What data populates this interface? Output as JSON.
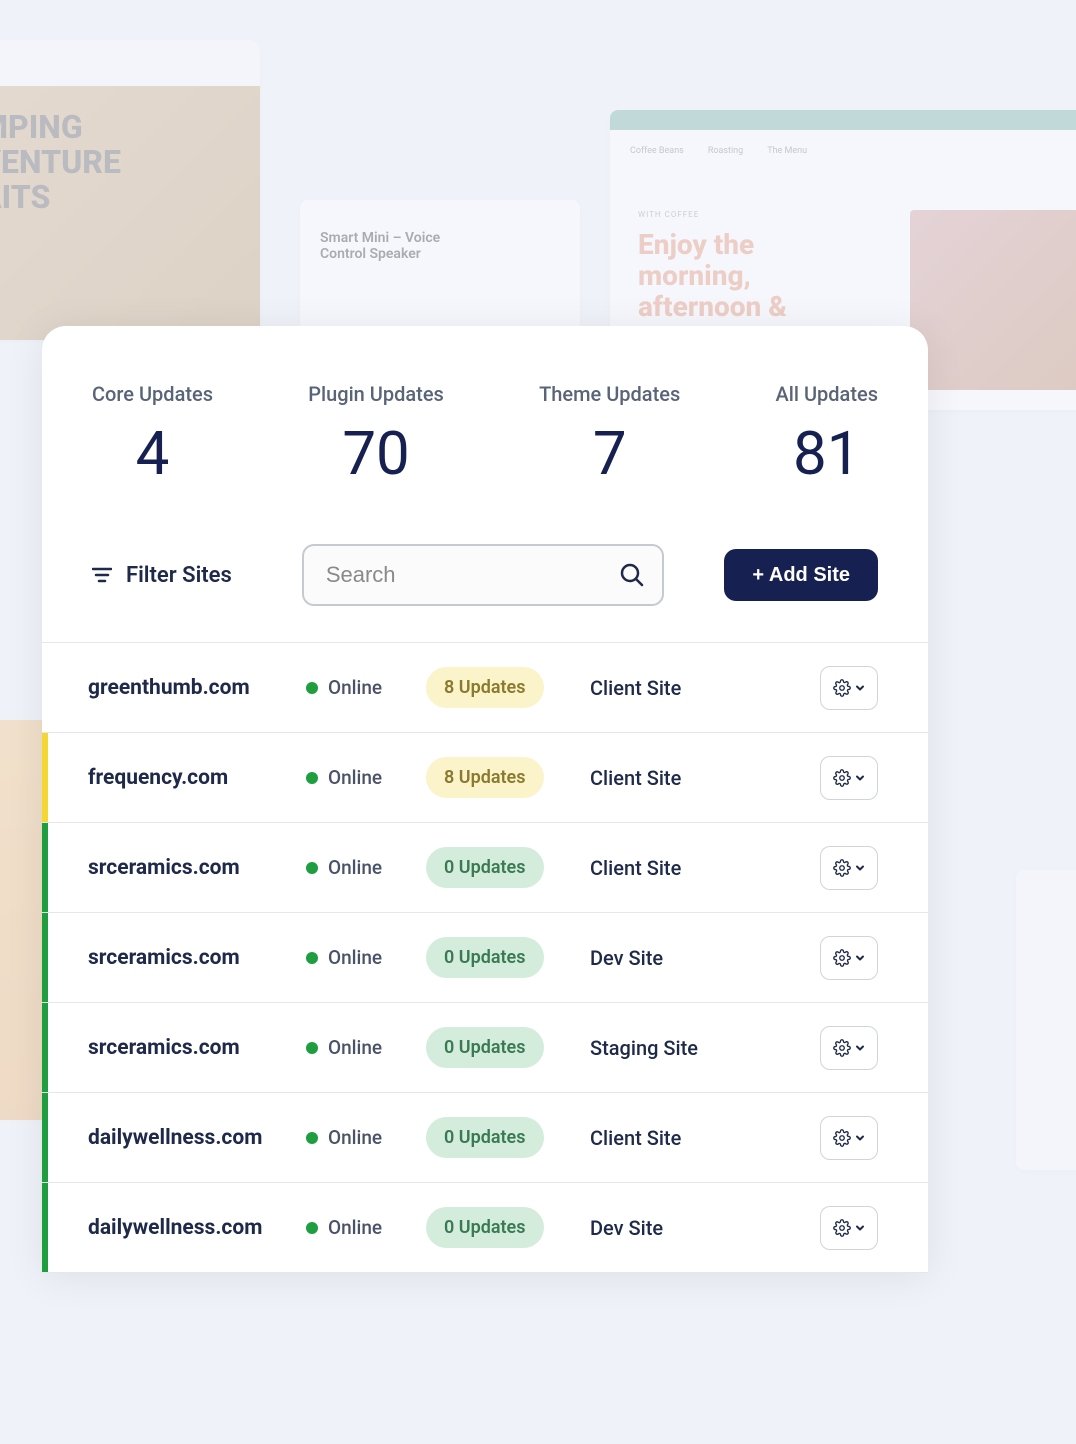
{
  "stats": [
    {
      "label": "Core Updates",
      "value": "4"
    },
    {
      "label": "Plugin Updates",
      "value": "70"
    },
    {
      "label": "Theme Updates",
      "value": "7"
    },
    {
      "label": "All Updates",
      "value": "81"
    }
  ],
  "controls": {
    "filter_label": "Filter Sites",
    "search_placeholder": "Search",
    "add_site_label": "+ Add Site"
  },
  "sites": [
    {
      "domain": "greenthumb.com",
      "status": "Online",
      "updates": "8 Updates",
      "updates_style": "yellow",
      "type": "Client Site",
      "accent": ""
    },
    {
      "domain": "frequency.com",
      "status": "Online",
      "updates": "8 Updates",
      "updates_style": "yellow",
      "type": "Client Site",
      "accent": "yellow"
    },
    {
      "domain": "srceramics.com",
      "status": "Online",
      "updates": "0 Updates",
      "updates_style": "green",
      "type": "Client Site",
      "accent": "green"
    },
    {
      "domain": "srceramics.com",
      "status": "Online",
      "updates": "0 Updates",
      "updates_style": "green",
      "type": "Dev Site",
      "accent": "green"
    },
    {
      "domain": "srceramics.com",
      "status": "Online",
      "updates": "0 Updates",
      "updates_style": "green",
      "type": "Staging Site",
      "accent": "green"
    },
    {
      "domain": "dailywellness.com",
      "status": "Online",
      "updates": "0 Updates",
      "updates_style": "green",
      "type": "Client Site",
      "accent": "green"
    },
    {
      "domain": "dailywellness.com",
      "status": "Online",
      "updates": "0 Updates",
      "updates_style": "green",
      "type": "Dev Site",
      "accent": "green"
    }
  ],
  "colors": {
    "primary": "#162152",
    "accent_yellow": "#f5d733",
    "accent_green": "#1f9e3f"
  }
}
